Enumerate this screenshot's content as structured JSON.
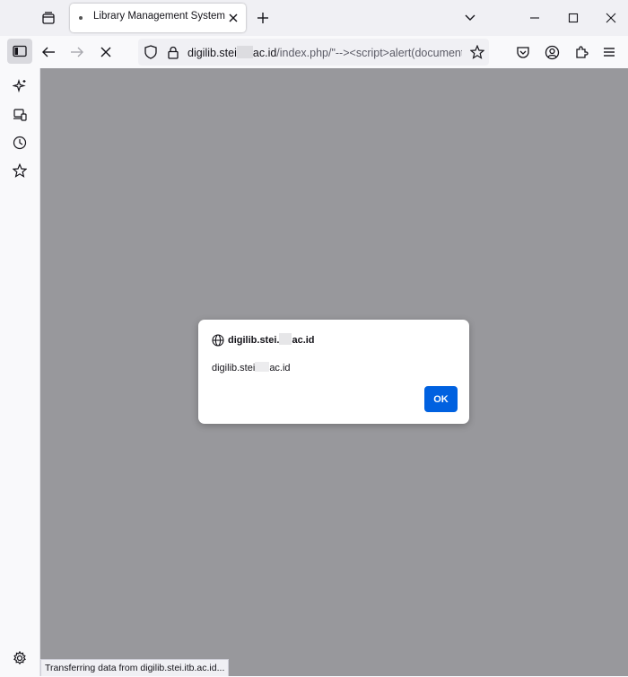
{
  "browser": {
    "active_tab": {
      "title": "Library Management System | ST"
    },
    "url": {
      "host_prefix": "digilib.stei",
      "host_suffix": "ac.id",
      "path": "/index.php/\"--><script>alert(document"
    },
    "status_text": "Transferring data from digilib.stei.itb.ac.id..."
  },
  "dialog": {
    "title_prefix": "digilib.stei.",
    "title_suffix": "ac.id",
    "message_prefix": "digilib.stei",
    "message_suffix": "ac.id",
    "ok_label": "OK"
  },
  "icons": {
    "tab_list": "tab-list-icon",
    "favicon": "favicon-icon",
    "close_tab": "close-icon",
    "new_tab": "plus-icon",
    "tabs_menu": "chevron-down-icon",
    "minimize": "minimize-icon",
    "maximize": "maximize-icon",
    "close_window": "close-icon",
    "sidebar": "sidebar-icon",
    "back": "back-arrow-icon",
    "forward": "forward-arrow-icon",
    "stop": "stop-icon",
    "shield": "shield-icon",
    "lock": "lock-icon",
    "bookmark": "star-icon",
    "pocket": "pocket-icon",
    "account": "account-icon",
    "extensions": "puzzle-icon",
    "menu": "hamburger-icon",
    "sidebar_ai": "sparkle-icon",
    "sidebar_sync": "synced-tabs-icon",
    "sidebar_history": "history-icon",
    "sidebar_bookmarks": "star-icon",
    "sidebar_settings": "gear-icon",
    "dialog_globe": "globe-icon"
  },
  "colors": {
    "ok_button": "#0061e0",
    "overlay": "#98989c",
    "chrome": "#f0f0f4"
  }
}
